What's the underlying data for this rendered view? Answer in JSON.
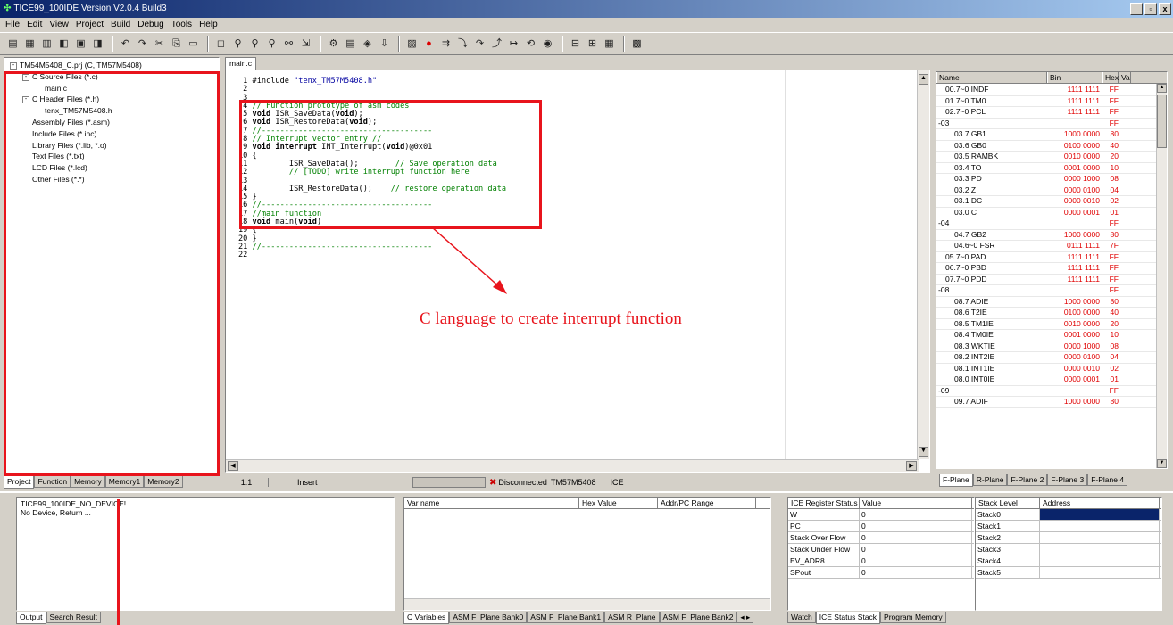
{
  "window": {
    "title": "TICE99_100IDE Version V2.0.4 Build3",
    "controls": [
      "_",
      "²",
      "x"
    ]
  },
  "menu": [
    "File",
    "Edit",
    "View",
    "Project",
    "Build",
    "Debug",
    "Tools",
    "Help"
  ],
  "toolbar_icons": [
    "new-file-icon",
    "open-folder-icon",
    "open-project-icon",
    "close-icon",
    "save-icon",
    "save-all-icon",
    "undo-icon",
    "redo-icon",
    "cut-icon",
    "copy-icon",
    "paste-icon",
    "clear-icon",
    "find-icon",
    "find-next-icon",
    "find-prev-icon",
    "replace-icon",
    "goto-icon",
    "compile-icon",
    "build-icon",
    "rebuild-icon",
    "download-icon",
    "ice-icon",
    "breakpoint-icon",
    "run-icon",
    "step-into-icon",
    "step-over-icon",
    "step-out-icon",
    "run-to-cursor-icon",
    "reset-icon",
    "stop-icon",
    "watch-icon",
    "memory-icon",
    "window-icon",
    "layout-icon"
  ],
  "project_tree": [
    {
      "label": "TM54M5408_C.prj (C, TM57M5408)",
      "level": 0,
      "toggle": "-"
    },
    {
      "label": "C Source Files (*.c)",
      "level": 1,
      "toggle": "-"
    },
    {
      "label": "main.c",
      "level": 2,
      "toggle": ""
    },
    {
      "label": "C Header Files (*.h)",
      "level": 1,
      "toggle": "-"
    },
    {
      "label": "tenx_TM57M5408.h",
      "level": 2,
      "toggle": ""
    },
    {
      "label": "Assembly Files (*.asm)",
      "level": 1,
      "toggle": ""
    },
    {
      "label": "Include Files (*.inc)",
      "level": 1,
      "toggle": ""
    },
    {
      "label": "Library Files (*.lib, *.o)",
      "level": 1,
      "toggle": ""
    },
    {
      "label": "Text Files (*.txt)",
      "level": 1,
      "toggle": ""
    },
    {
      "label": "LCD Files (*.lcd)",
      "level": 1,
      "toggle": ""
    },
    {
      "label": "Other Files (*.*)",
      "level": 1,
      "toggle": ""
    }
  ],
  "left_tabs": [
    "Project",
    "Function",
    "Memory",
    "Memory1",
    "Memory2"
  ],
  "editor": {
    "tab": "main.c",
    "lines": [
      [
        {
          "t": "#include ",
          "c": "kw0"
        },
        {
          "t": "\"tenx_TM57M5408.h\"",
          "c": "st"
        }
      ],
      [],
      [],
      [
        {
          "t": "// Function prototype of asm codes",
          "c": "cm"
        }
      ],
      [
        {
          "t": "void",
          "c": "kw"
        },
        {
          "t": " ISR_SaveData(",
          "c": ""
        },
        {
          "t": "void",
          "c": "kw"
        },
        {
          "t": ");",
          "c": ""
        }
      ],
      [
        {
          "t": "void",
          "c": "kw"
        },
        {
          "t": " ISR_RestoreData(",
          "c": ""
        },
        {
          "t": "void",
          "c": "kw"
        },
        {
          "t": ");",
          "c": ""
        }
      ],
      [
        {
          "t": "//-------------------------------------",
          "c": "cm"
        }
      ],
      [
        {
          "t": "// Interrupt vector entry //",
          "c": "cm"
        }
      ],
      [
        {
          "t": "void interrupt",
          "c": "kw"
        },
        {
          "t": " INT_Interrupt(",
          "c": ""
        },
        {
          "t": "void",
          "c": "kw"
        },
        {
          "t": ")@0x01",
          "c": ""
        }
      ],
      [
        {
          "t": "{",
          "c": ""
        }
      ],
      [
        {
          "t": "        ISR_SaveData();        ",
          "c": ""
        },
        {
          "t": "// Save operation data",
          "c": "cm"
        }
      ],
      [
        {
          "t": "        // [TODO] write interrupt function here",
          "c": "cm"
        }
      ],
      [],
      [
        {
          "t": "        ISR_RestoreData();    ",
          "c": ""
        },
        {
          "t": "// restore operation data",
          "c": "cm"
        }
      ],
      [
        {
          "t": "}",
          "c": ""
        }
      ],
      [
        {
          "t": "//-------------------------------------",
          "c": "cm"
        }
      ],
      [
        {
          "t": "//main function",
          "c": "cm"
        }
      ],
      [
        {
          "t": "void",
          "c": "kw"
        },
        {
          "t": " main(",
          "c": ""
        },
        {
          "t": "void",
          "c": "kw"
        },
        {
          "t": ")",
          "c": ""
        }
      ],
      [
        {
          "t": "{",
          "c": ""
        }
      ],
      [
        {
          "t": "}",
          "c": ""
        }
      ],
      [
        {
          "t": "//-------------------------------------",
          "c": "cm"
        }
      ],
      []
    ]
  },
  "annotation": {
    "text": "C language to create interrupt function",
    "color": "#e8141c"
  },
  "status": {
    "pos": "1:1",
    "mode": "Insert",
    "conn": "Disconnected",
    "device": "TM57M5408",
    "tool": "ICE"
  },
  "registers": {
    "headers": [
      "Name",
      "Bin",
      "Hex",
      "Va"
    ],
    "rows": [
      {
        "name": "00.7~0 INDF",
        "bin": "1111 1111",
        "hex": "FF",
        "lvl": 1,
        "tg": ""
      },
      {
        "name": "01.7~0 TM0",
        "bin": "1111 1111",
        "hex": "FF",
        "lvl": 1,
        "tg": ""
      },
      {
        "name": "02.7~0 PCL",
        "bin": "1111 1111",
        "hex": "FF",
        "lvl": 1,
        "tg": ""
      },
      {
        "name": "03",
        "bin": "",
        "hex": "FF",
        "lvl": 0,
        "tg": "-"
      },
      {
        "name": "03.7 GB1",
        "bin": "1000 0000",
        "hex": "80",
        "lvl": 2,
        "tg": ""
      },
      {
        "name": "03.6 GB0",
        "bin": "0100 0000",
        "hex": "40",
        "lvl": 2,
        "tg": ""
      },
      {
        "name": "03.5 RAMBK",
        "bin": "0010 0000",
        "hex": "20",
        "lvl": 2,
        "tg": ""
      },
      {
        "name": "03.4 TO",
        "bin": "0001 0000",
        "hex": "10",
        "lvl": 2,
        "tg": ""
      },
      {
        "name": "03.3 PD",
        "bin": "0000 1000",
        "hex": "08",
        "lvl": 2,
        "tg": ""
      },
      {
        "name": "03.2 Z",
        "bin": "0000 0100",
        "hex": "04",
        "lvl": 2,
        "tg": ""
      },
      {
        "name": "03.1 DC",
        "bin": "0000 0010",
        "hex": "02",
        "lvl": 2,
        "tg": ""
      },
      {
        "name": "03.0 C",
        "bin": "0000 0001",
        "hex": "01",
        "lvl": 2,
        "tg": ""
      },
      {
        "name": "04",
        "bin": "",
        "hex": "FF",
        "lvl": 0,
        "tg": "-"
      },
      {
        "name": "04.7 GB2",
        "bin": "1000 0000",
        "hex": "80",
        "lvl": 2,
        "tg": ""
      },
      {
        "name": "04.6~0 FSR",
        "bin": "0111 1111",
        "hex": "7F",
        "lvl": 2,
        "tg": ""
      },
      {
        "name": "05.7~0 PAD",
        "bin": "1111 1111",
        "hex": "FF",
        "lvl": 1,
        "tg": ""
      },
      {
        "name": "06.7~0 PBD",
        "bin": "1111 1111",
        "hex": "FF",
        "lvl": 1,
        "tg": ""
      },
      {
        "name": "07.7~0 PDD",
        "bin": "1111 1111",
        "hex": "FF",
        "lvl": 1,
        "tg": ""
      },
      {
        "name": "08",
        "bin": "",
        "hex": "FF",
        "lvl": 0,
        "tg": "-"
      },
      {
        "name": "08.7 ADIE",
        "bin": "1000 0000",
        "hex": "80",
        "lvl": 2,
        "tg": ""
      },
      {
        "name": "08.6 T2IE",
        "bin": "0100 0000",
        "hex": "40",
        "lvl": 2,
        "tg": ""
      },
      {
        "name": "08.5 TM1IE",
        "bin": "0010 0000",
        "hex": "20",
        "lvl": 2,
        "tg": ""
      },
      {
        "name": "08.4 TM0IE",
        "bin": "0001 0000",
        "hex": "10",
        "lvl": 2,
        "tg": ""
      },
      {
        "name": "08.3 WKTIE",
        "bin": "0000 1000",
        "hex": "08",
        "lvl": 2,
        "tg": ""
      },
      {
        "name": "08.2 INT2IE",
        "bin": "0000 0100",
        "hex": "04",
        "lvl": 2,
        "tg": ""
      },
      {
        "name": "08.1 INT1IE",
        "bin": "0000 0010",
        "hex": "02",
        "lvl": 2,
        "tg": ""
      },
      {
        "name": "08.0 INT0IE",
        "bin": "0000 0001",
        "hex": "01",
        "lvl": 2,
        "tg": ""
      },
      {
        "name": "09",
        "bin": "",
        "hex": "FF",
        "lvl": 0,
        "tg": "-"
      },
      {
        "name": "09.7 ADIF",
        "bin": "1000 0000",
        "hex": "80",
        "lvl": 2,
        "tg": ""
      }
    ]
  },
  "right_tabs": [
    "F-Plane",
    "R-Plane",
    "F-Plane 2",
    "F-Plane 3",
    "F-Plane 4"
  ],
  "output": {
    "lines": [
      "TICE99_100IDE_NO_DEVICE!",
      "No Device, Return ..."
    ],
    "tabs": [
      "Output",
      "Search Result"
    ]
  },
  "variables": {
    "headers": [
      "Var name",
      "Hex Value",
      "Addr/PC Range"
    ],
    "tabs": [
      "C Variables",
      "ASM F_Plane Bank0",
      "ASM F_Plane Bank1",
      "ASM R_Plane",
      "ASM F_Plane Bank2"
    ]
  },
  "ice_status": {
    "headers": [
      "ICE Register Status",
      "Value"
    ],
    "rows": [
      [
        "W",
        "0"
      ],
      [
        "PC",
        "0"
      ],
      [
        "Stack Over Flow",
        "0"
      ],
      [
        "Stack Under Flow",
        "0"
      ],
      [
        "EV_ADR8",
        "0"
      ],
      [
        "SPout",
        "0"
      ]
    ]
  },
  "stack": {
    "headers": [
      "Stack Level",
      "Address"
    ],
    "rows": [
      "Stack0",
      "Stack1",
      "Stack2",
      "Stack3",
      "Stack4",
      "Stack5"
    ]
  },
  "bottom_tabs": [
    "Watch",
    "ICE Status Stack",
    "Program Memory"
  ]
}
